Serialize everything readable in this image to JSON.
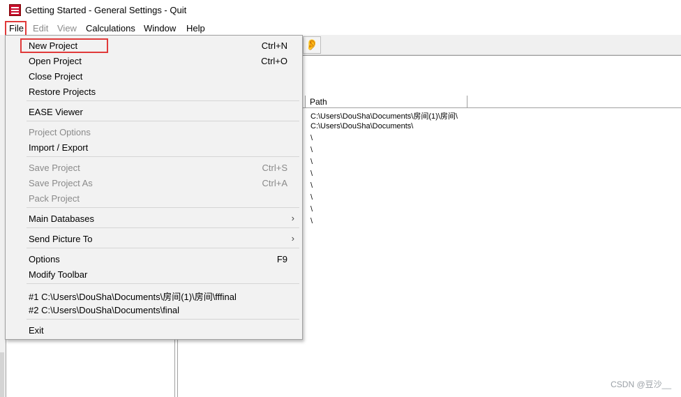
{
  "window": {
    "title": "Getting Started - General Settings - Quit",
    "app_icon": "ease-logo-icon"
  },
  "menubar": {
    "items": [
      {
        "label": "File",
        "disabled": false
      },
      {
        "label": "Edit",
        "disabled": true
      },
      {
        "label": "View",
        "disabled": true
      },
      {
        "label": "Calculations",
        "disabled": false
      },
      {
        "label": "Window",
        "disabled": false
      },
      {
        "label": "Help",
        "disabled": false
      }
    ]
  },
  "file_menu": {
    "items": [
      {
        "label": "New Project",
        "shortcut": "Ctrl+N"
      },
      {
        "label": "Open Project",
        "shortcut": "Ctrl+O"
      },
      {
        "label": "Close Project",
        "shortcut": ""
      },
      {
        "label": "Restore Projects",
        "shortcut": ""
      },
      {
        "label": "EASE Viewer",
        "shortcut": ""
      },
      {
        "label": "Project Options",
        "shortcut": ""
      },
      {
        "label": "Import / Export",
        "shortcut": ""
      },
      {
        "label": "Save Project",
        "shortcut": "Ctrl+S"
      },
      {
        "label": "Save Project As",
        "shortcut": "Ctrl+A"
      },
      {
        "label": "Pack Project",
        "shortcut": ""
      },
      {
        "label": "Main Databases",
        "shortcut": ""
      },
      {
        "label": "Send Picture To",
        "shortcut": ""
      },
      {
        "label": "Options",
        "shortcut": "F9"
      },
      {
        "label": "Modify Toolbar",
        "shortcut": ""
      },
      {
        "label": "#1 C:\\Users\\DouSha\\Documents\\房间(1)\\房间\\fffinal",
        "shortcut": ""
      },
      {
        "label": "#2 C:\\Users\\DouSha\\Documents\\final",
        "shortcut": ""
      },
      {
        "label": "Exit",
        "shortcut": ""
      }
    ]
  },
  "project_list": {
    "columns": [
      "Path"
    ],
    "rows": [
      "C:\\Users\\DouSha\\Documents\\房间(1)\\房间\\",
      "C:\\Users\\DouSha\\Documents\\",
      "\\",
      "\\",
      "\\",
      "\\",
      "\\",
      "\\",
      "\\",
      "\\"
    ]
  },
  "toolbar": {
    "ear_icon": "ear-icon"
  },
  "watermark": "CSDN @豆沙__",
  "colors": {
    "highlight_box": "#e03a3a",
    "menu_bg": "#f2f2f2"
  }
}
